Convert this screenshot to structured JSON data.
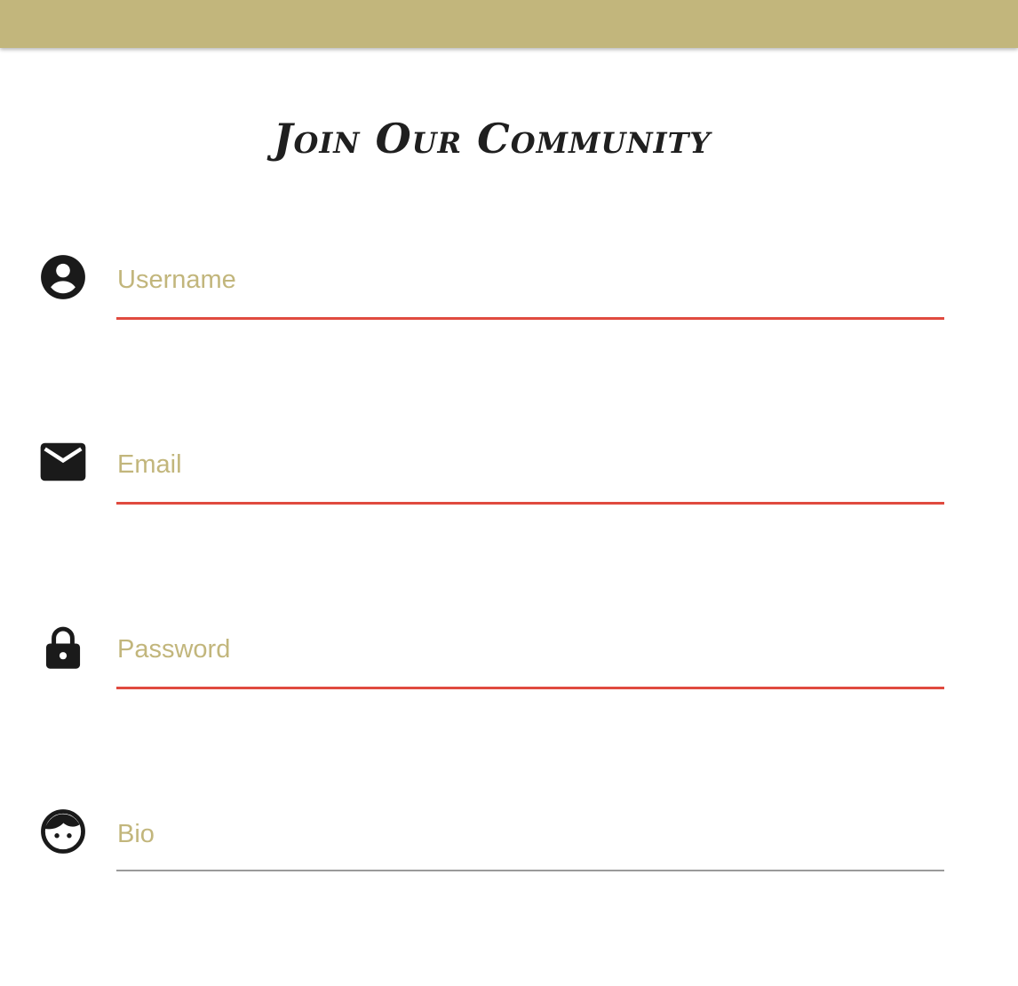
{
  "header": {
    "bar_color": "#c2b67c"
  },
  "form": {
    "title": "Join Our Community",
    "fields": [
      {
        "name": "username",
        "placeholder": "Username",
        "value": "",
        "icon": "account-circle-icon",
        "underline_color": "#e04a3f"
      },
      {
        "name": "email",
        "placeholder": "Email",
        "value": "",
        "icon": "mail-icon",
        "underline_color": "#e04a3f"
      },
      {
        "name": "password",
        "placeholder": "Password",
        "value": "",
        "icon": "lock-icon",
        "underline_color": "#e04a3f"
      },
      {
        "name": "bio",
        "placeholder": "Bio",
        "value": "",
        "icon": "face-icon",
        "underline_color": "#9a9a9a"
      }
    ]
  },
  "colors": {
    "accent": "#c2b67c",
    "error": "#e04a3f",
    "neutral_line": "#9a9a9a",
    "icon": "#1a1a1a"
  }
}
